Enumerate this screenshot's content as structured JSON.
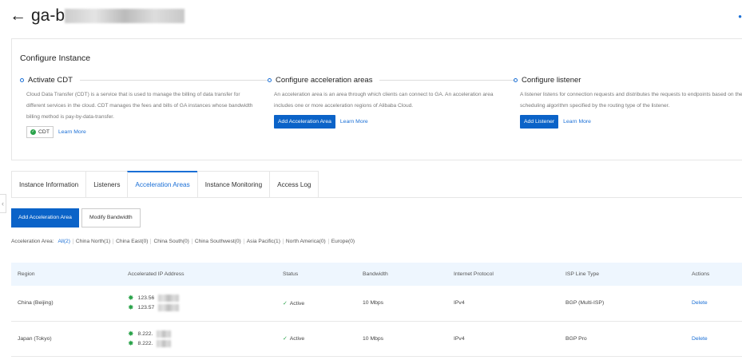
{
  "header": {
    "title_prefix": "ga-b",
    "back_icon": "arrow-left-icon"
  },
  "configure": {
    "title": "Configure Instance",
    "steps": [
      {
        "title": "Activate CDT",
        "desc": "Cloud Data Transfer (CDT) is a service that is used to manage the billing of data transfer for different services in the cloud. CDT manages the fees and bills of GA instances whose bandwidth billing method is pay-by-data-transfer.",
        "button": "CDT",
        "link": "Learn More"
      },
      {
        "title": "Configure acceleration areas",
        "desc": "An acceleration area is an area through which clients can connect to GA. An acceleration area includes one or more acceleration regions of Alibaba Cloud.",
        "button": "Add Acceleration Area",
        "link": "Learn More"
      },
      {
        "title": "Configure listener",
        "desc": "A listener listens for connection requests and distributes the requests to endpoints based on the scheduling algorithm specified by the routing type of the listener.",
        "button": "Add Listener",
        "link": "Learn More"
      }
    ]
  },
  "tabs": [
    {
      "label": "Instance Information"
    },
    {
      "label": "Listeners"
    },
    {
      "label": "Acceleration Areas",
      "active": true
    },
    {
      "label": "Instance Monitoring"
    },
    {
      "label": "Access Log"
    }
  ],
  "toolbar": {
    "add": "Add Acceleration Area",
    "modify": "Modify Bandwidth"
  },
  "filter": {
    "label": "Acceleration Area:",
    "items": [
      "All(2)",
      "China North(1)",
      "China East(0)",
      "China South(0)",
      "China Southwest(0)",
      "Asia Pacific(1)",
      "North America(0)",
      "Europe(0)"
    ],
    "selected": "All(2)"
  },
  "table": {
    "columns": [
      "Region",
      "Accelerated IP Address",
      "Status",
      "Bandwidth",
      "Internet Protocol",
      "ISP Line Type",
      "Actions"
    ],
    "rows": [
      {
        "region": "China (Beijing)",
        "ips": [
          "123.56",
          "123.57"
        ],
        "status": "Active",
        "bandwidth": "10 Mbps",
        "protocol": "IPv4",
        "isp": "BGP (Multi-ISP)",
        "action": "Delete"
      },
      {
        "region": "Japan (Tokyo)",
        "ips": [
          "8.222.",
          "8.222."
        ],
        "status": "Active",
        "bandwidth": "10 Mbps",
        "protocol": "IPv4",
        "isp": "BGP Pro",
        "action": "Delete"
      }
    ]
  },
  "colors": {
    "primary": "#0b63c8",
    "link": "#1a6fd6",
    "success": "#2aa34a",
    "table_header": "#eef6fe"
  }
}
